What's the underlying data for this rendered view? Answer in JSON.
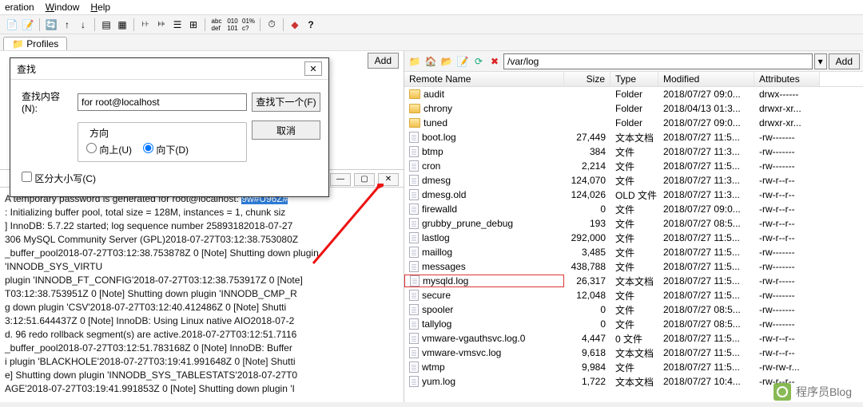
{
  "menu": {
    "items": [
      "eration",
      "Window",
      "Help"
    ],
    "underlines": [
      "",
      "W",
      "H"
    ]
  },
  "tabs": {
    "profiles": "Profiles"
  },
  "dialog": {
    "title": "查找",
    "label_find": "查找内容(N):",
    "value": "for root@localhost",
    "btn_find": "查找下一个(F)",
    "btn_cancel": "取消",
    "group_title": "方向",
    "radio_up": "向上(U)",
    "radio_down": "向下(D)",
    "cb_case": "区分大小写(C)"
  },
  "left_add": "Add",
  "right": {
    "add": "Add",
    "path": "/var/log",
    "headers": [
      "Remote Name",
      "Size",
      "Type",
      "Modified",
      "Attributes"
    ]
  },
  "files": [
    {
      "n": "audit",
      "s": "",
      "t": "Folder",
      "m": "2018/07/27 09:0...",
      "a": "drwx------",
      "f": true
    },
    {
      "n": "chrony",
      "s": "",
      "t": "Folder",
      "m": "2018/04/13 01:3...",
      "a": "drwxr-xr...",
      "f": true
    },
    {
      "n": "tuned",
      "s": "",
      "t": "Folder",
      "m": "2018/07/27 09:0...",
      "a": "drwxr-xr...",
      "f": true
    },
    {
      "n": "boot.log",
      "s": "27,449",
      "t": "文本文档",
      "m": "2018/07/27 11:5...",
      "a": "-rw-------"
    },
    {
      "n": "btmp",
      "s": "384",
      "t": "文件",
      "m": "2018/07/27 11:3...",
      "a": "-rw-------"
    },
    {
      "n": "cron",
      "s": "2,214",
      "t": "文件",
      "m": "2018/07/27 11:5...",
      "a": "-rw-------"
    },
    {
      "n": "dmesg",
      "s": "124,070",
      "t": "文件",
      "m": "2018/07/27 11:3...",
      "a": "-rw-r--r--"
    },
    {
      "n": "dmesg.old",
      "s": "124,026",
      "t": "OLD 文件",
      "m": "2018/07/27 11:3...",
      "a": "-rw-r--r--"
    },
    {
      "n": "firewalld",
      "s": "0",
      "t": "文件",
      "m": "2018/07/27 09:0...",
      "a": "-rw-r--r--"
    },
    {
      "n": "grubby_prune_debug",
      "s": "193",
      "t": "文件",
      "m": "2018/07/27 08:5...",
      "a": "-rw-r--r--"
    },
    {
      "n": "lastlog",
      "s": "292,000",
      "t": "文件",
      "m": "2018/07/27 11:5...",
      "a": "-rw-r--r--"
    },
    {
      "n": "maillog",
      "s": "3,485",
      "t": "文件",
      "m": "2018/07/27 11:5...",
      "a": "-rw-------"
    },
    {
      "n": "messages",
      "s": "438,788",
      "t": "文件",
      "m": "2018/07/27 11:5...",
      "a": "-rw-------"
    },
    {
      "n": "mysqld.log",
      "s": "26,317",
      "t": "文本文档",
      "m": "2018/07/27 11:5...",
      "a": "-rw-r-----",
      "hl": true
    },
    {
      "n": "secure",
      "s": "12,048",
      "t": "文件",
      "m": "2018/07/27 11:5...",
      "a": "-rw-------"
    },
    {
      "n": "spooler",
      "s": "0",
      "t": "文件",
      "m": "2018/07/27 08:5...",
      "a": "-rw-------"
    },
    {
      "n": "tallylog",
      "s": "0",
      "t": "文件",
      "m": "2018/07/27 08:5...",
      "a": "-rw-------"
    },
    {
      "n": "vmware-vgauthsvc.log.0",
      "s": "4,447",
      "t": "0 文件",
      "m": "2018/07/27 11:5...",
      "a": "-rw-r--r--"
    },
    {
      "n": "vmware-vmsvc.log",
      "s": "9,618",
      "t": "文本文档",
      "m": "2018/07/27 11:5...",
      "a": "-rw-r--r--"
    },
    {
      "n": "wtmp",
      "s": "9,984",
      "t": "文件",
      "m": "2018/07/27 11:5...",
      "a": "-rw-rw-r..."
    },
    {
      "n": "yum.log",
      "s": "1,722",
      "t": "文本文档",
      "m": "2018/07/27 10:4...",
      "a": "-rw-r--r--"
    }
  ],
  "log": {
    "lines": [
      "A temporary password is generated for root@localhost: ",
      ": Initializing buffer pool, total size = 128M, instances = 1, chunk siz",
      "] InnoDB: 5.7.22 started; log sequence number 25893182018-07-27",
      "306  MySQL Community Server (GPL)2018-07-27T03:12:38.753080Z",
      "_buffer_pool2018-07-27T03:12:38.753878Z 0 [Note] Shutting down plugin 'INNODB_SYS_VIRTU",
      "plugin 'INNODB_FT_CONFIG'2018-07-27T03:12:38.753917Z 0 [Note]",
      "T03:12:38.753951Z 0 [Note] Shutting down plugin 'INNODB_CMP_R",
      "g down plugin 'CSV'2018-07-27T03:12:40.412486Z 0 [Note] Shutti",
      "3:12:51.644437Z 0 [Note] InnoDB: Using Linux native AIO2018-07-2",
      "d. 96 redo rollback segment(s) are active.2018-07-27T03:12:51.7116",
      "_buffer_pool2018-07-27T03:12:51.783168Z 0 [Note] InnoDB: Buffer",
      "i plugin 'BLACKHOLE'2018-07-27T03:19:41.991648Z 0 [Note] Shutti",
      "e] Shutting down plugin 'INNODB_SYS_TABLESTATS'2018-07-27T0",
      "AGE'2018-07-27T03:19:41.991853Z 0 [Note] Shutting down plugin 'I"
    ],
    "highlight": "9w#U96Z#"
  },
  "watermark": "程序员Blog",
  "icons": {
    "tool_icons": [
      "📄",
      "📝",
      "📂",
      "🔄",
      "⬆",
      "⬇",
      "🗂",
      "≡",
      "☰",
      "⋮",
      "⊞",
      "abc",
      "010",
      "01%",
      "⏰",
      "🔔",
      "❓"
    ],
    "path_icons": [
      "📁",
      "🏠",
      "📂",
      "📝",
      "🔄",
      "✖"
    ]
  }
}
